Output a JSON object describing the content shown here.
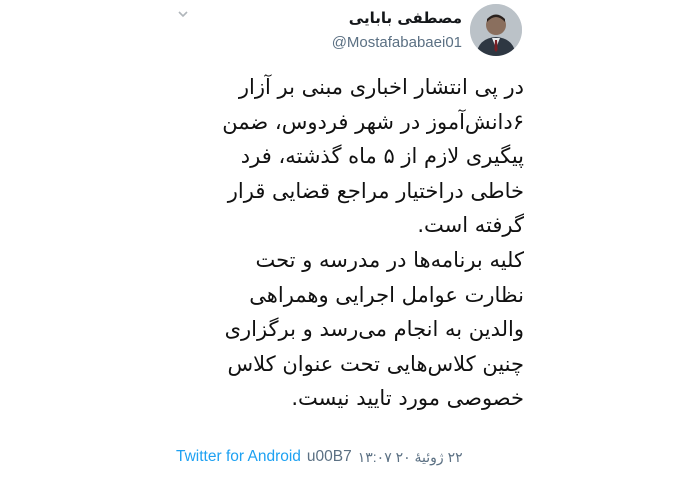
{
  "tweet": {
    "display_name": "مصطفی بابایی",
    "handle": "@Mostafababaei01",
    "text": "در پی انتشار اخباری مبنی بر آزار\n۶دانش‌آموز در شهر فردوس، ضمن\nپیگیری لازم از ۵ ماه گذشته، فرد\nخاطی دراختیار مراجع قضایی قرار\nگرفته است.\nکلیه برنامه‌ها در مدرسه و تحت\nنظارت عوامل اجرایی وهمراهی\nوالدین به انجام می‌رسد و برگزاری\nچنین کلاس‌هایی تحت عنوان کلاس\nخصوصی مورد تایید نیست.",
    "source": "Twitter for Android",
    "code": "u00B7",
    "timestamp": "۲۲ ژوئیهٔ ۲۰ ۱۳:۰۷"
  },
  "icons": {
    "menu": "chevron-down-icon",
    "avatar": "avatar"
  },
  "colors": {
    "source_link": "#1da1f2",
    "secondary_text": "#5b7083",
    "primary_text": "#111111"
  }
}
